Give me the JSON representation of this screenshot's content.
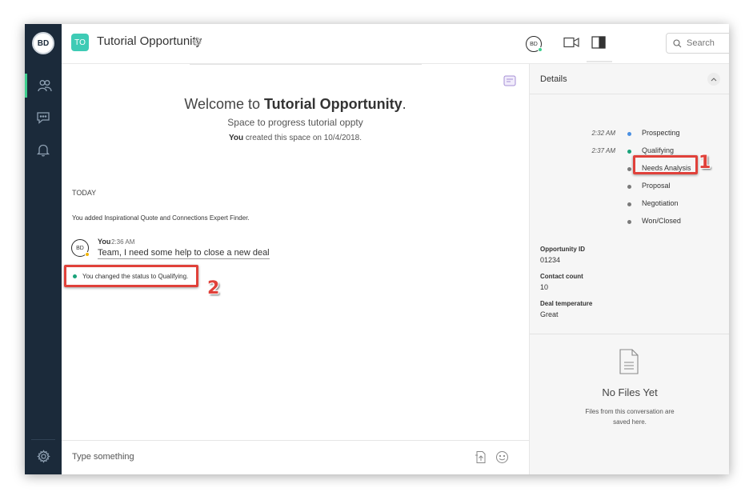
{
  "user": {
    "initials": "BD"
  },
  "header": {
    "space_initials": "TO",
    "space_title": "Tutorial Opportunity",
    "participant_initials": "BD",
    "search_placeholder": "Search"
  },
  "main": {
    "welcome_prefix": "Welcome to ",
    "welcome_name": "Tutorial Opportunity",
    "welcome_suffix": ".",
    "subtitle": "Space to progress tutorial oppty",
    "created_by": "You",
    "created_text": " created this space on 10/4/2018.",
    "day_label": "TODAY",
    "added_text": "You added Inspirational Quote and Connections Expert Finder.",
    "message": {
      "avatar_initials": "BD",
      "author": "You",
      "time": "2:36 AM",
      "text": "Team, I need some help to close a new deal"
    },
    "status_change_text": "You changed the status to Qualifying.",
    "callout_status": "2"
  },
  "composer": {
    "placeholder": "Type something"
  },
  "details": {
    "title": "Details",
    "stages": [
      {
        "time": "2:32 AM",
        "label": "Prospecting",
        "color": "#4a90e2"
      },
      {
        "time": "2:37 AM",
        "label": "Qualifying",
        "color": "#1aa37a"
      },
      {
        "time": "",
        "label": "Needs Analysis",
        "color": "#7a7a7a"
      },
      {
        "time": "",
        "label": "Proposal",
        "color": "#7a7a7a"
      },
      {
        "time": "",
        "label": "Negotiation",
        "color": "#7a7a7a"
      },
      {
        "time": "",
        "label": "Won/Closed",
        "color": "#7a7a7a"
      }
    ],
    "callout_stage": "1",
    "fields": [
      {
        "label": "Opportunity ID",
        "value": "01234"
      },
      {
        "label": "Contact count",
        "value": "10"
      },
      {
        "label": "Deal temperature",
        "value": "Great"
      }
    ],
    "files_title": "No Files Yet",
    "files_note": "Files from this conversation are saved here."
  },
  "colors": {
    "rail": "#1b2a3a",
    "accent": "#3ecf8e",
    "badge": "#3ecbb5",
    "highlight": "#e0413a"
  }
}
